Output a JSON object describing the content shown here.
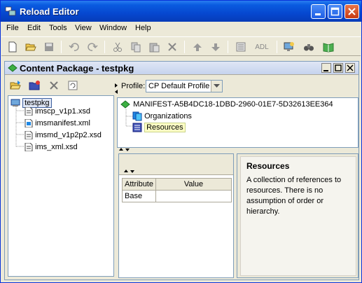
{
  "window": {
    "title": "Reload Editor"
  },
  "menu": [
    "File",
    "Edit",
    "Tools",
    "View",
    "Window",
    "Help"
  ],
  "toolbar": {
    "adl_label": "ADL"
  },
  "content_package": {
    "title": "Content Package - testpkg",
    "file_tree": {
      "root": "testpkg",
      "children": [
        "imscp_v1p1.xsd",
        "imsmanifest.xml",
        "imsmd_v1p2p2.xsd",
        "ims_xml.xsd"
      ]
    },
    "profile": {
      "label": "Profile:",
      "value": "CP Default Profile"
    },
    "manifest_tree": {
      "root": "MANIFEST-A5B4DC18-1DBD-2960-01E7-5D32613EE364",
      "children": [
        "Organizations",
        "Resources"
      ]
    },
    "attributes": {
      "headers": [
        "Attribute",
        "Value"
      ],
      "rows": [
        [
          "Base",
          ""
        ]
      ]
    },
    "description": {
      "title": "Resources",
      "text": "A collection of references to resources. There is no assumption of order or hierarchy."
    }
  }
}
